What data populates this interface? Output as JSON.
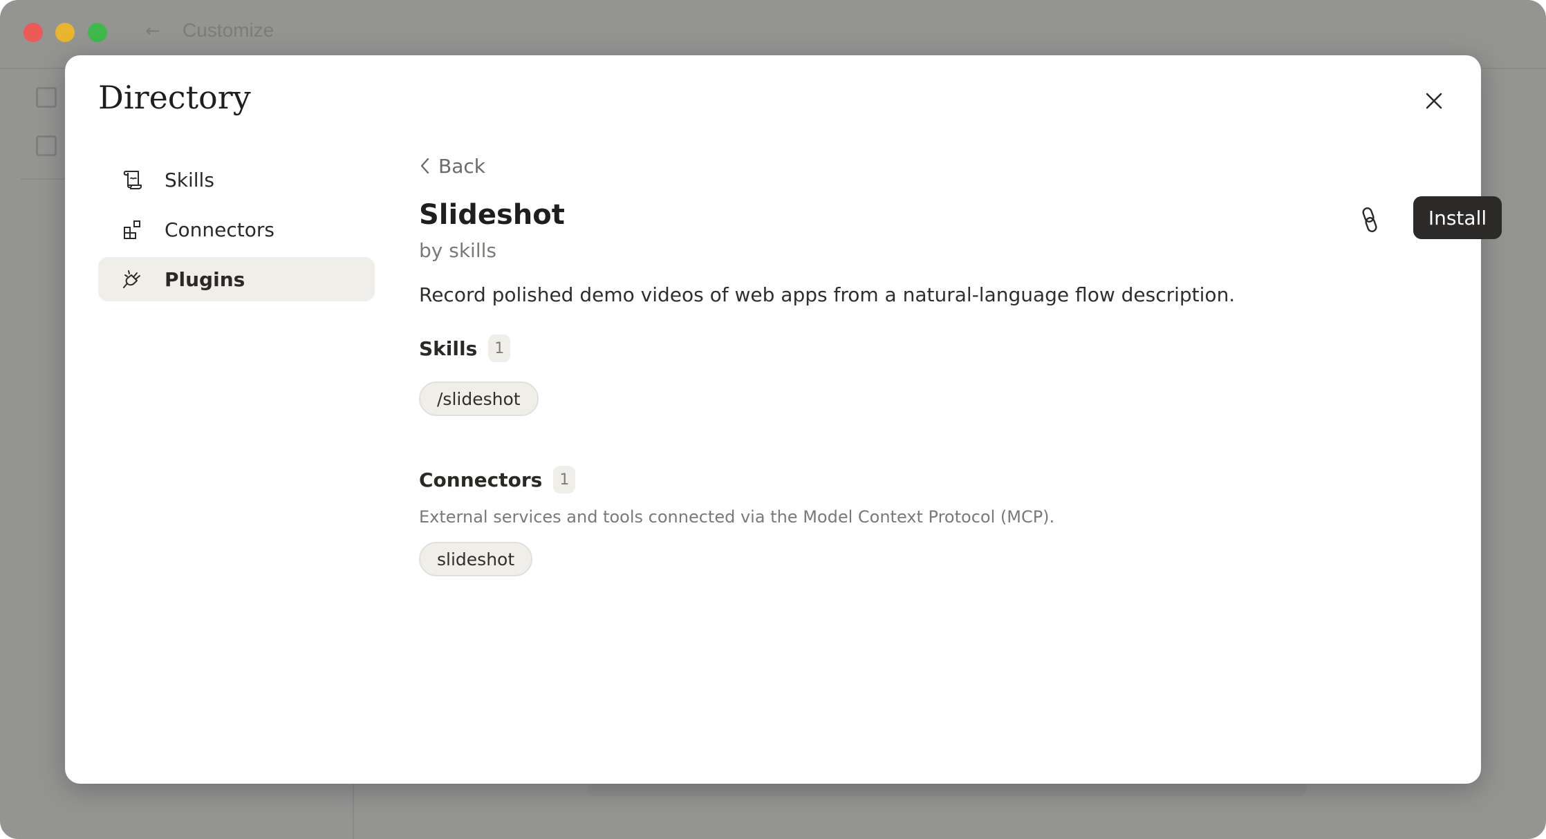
{
  "window": {
    "background_title": "Customize"
  },
  "modal": {
    "title": "Directory"
  },
  "nav": {
    "items": [
      {
        "label": "Skills",
        "icon": "scroll-icon"
      },
      {
        "label": "Connectors",
        "icon": "grid-plus-icon"
      },
      {
        "label": "Plugins",
        "icon": "plug-icon",
        "active": true
      }
    ]
  },
  "detail": {
    "back_label": "Back",
    "title": "Slideshot",
    "author": "by skills",
    "install_label": "Install",
    "description": "Record polished demo videos of web apps from a natural-language flow description.",
    "skills": {
      "title": "Skills",
      "count": "1",
      "items": [
        "/slideshot"
      ]
    },
    "connectors": {
      "title": "Connectors",
      "count": "1",
      "subtitle": "External services and tools connected via the Model Context Protocol (MCP).",
      "items": [
        "slideshot"
      ]
    }
  },
  "colors": {
    "accent_dark": "#2b2a28",
    "active_nav_bg": "#f0eee9",
    "overlay": "#949493"
  }
}
